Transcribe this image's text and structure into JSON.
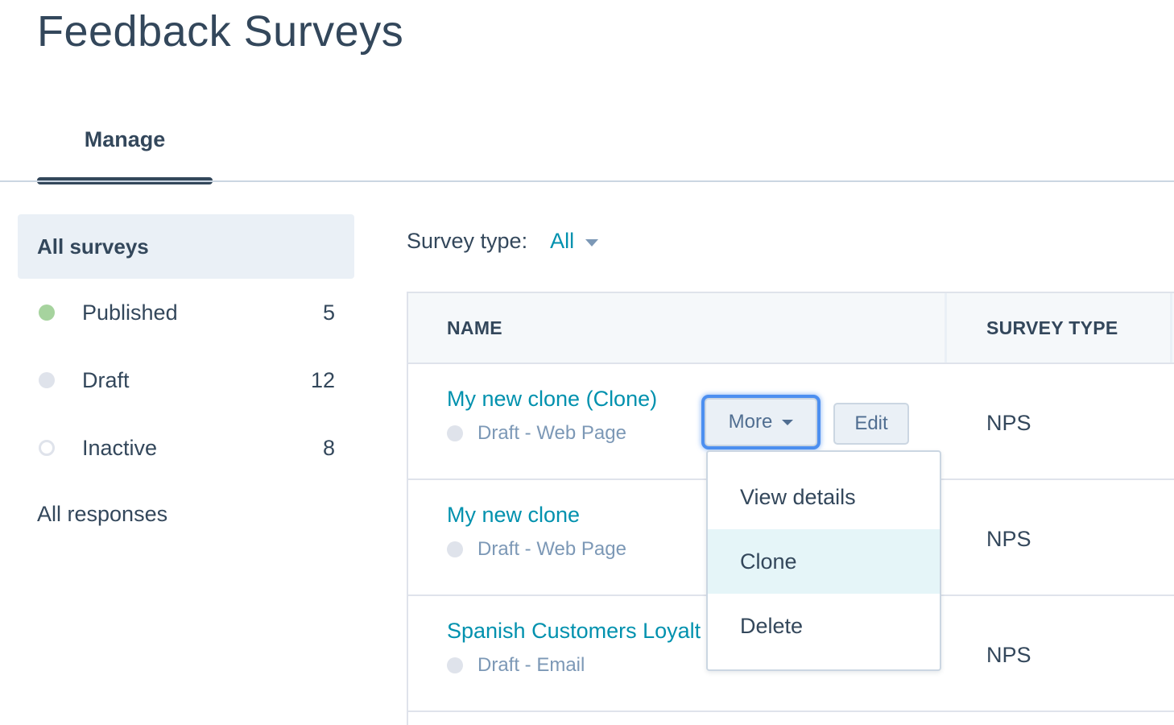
{
  "page": {
    "title": "Feedback Surveys"
  },
  "tabs": [
    {
      "label": "Manage"
    }
  ],
  "sidebar": {
    "active_label": "All surveys",
    "statuses": [
      {
        "label": "Published",
        "count": "5",
        "dot_color": "#a6d39e"
      },
      {
        "label": "Draft",
        "count": "12",
        "dot_color": "#dfe3eb"
      },
      {
        "label": "Inactive",
        "count": "8",
        "dot_color": "hollow"
      }
    ],
    "responses_label": "All responses"
  },
  "filter": {
    "label": "Survey type:",
    "value": "All"
  },
  "table": {
    "columns": [
      "NAME",
      "SURVEY TYPE"
    ],
    "rows": [
      {
        "name": "My new clone (Clone)",
        "status": "Draft - Web Page",
        "type": "NPS"
      },
      {
        "name": "My new clone",
        "status": "Draft - Web Page",
        "type": "NPS"
      },
      {
        "name": "Spanish Customers Loyalt",
        "status": "Draft - Email",
        "type": "NPS"
      }
    ]
  },
  "row_actions": {
    "more_label": "More",
    "edit_label": "Edit"
  },
  "dropdown": {
    "items": [
      "View details",
      "Clone",
      "Delete"
    ],
    "highlighted": "Clone"
  },
  "colors": {
    "link": "#0091ae",
    "text": "#33475b",
    "muted": "#7c98b6",
    "focus_ring": "#4c8ff0"
  }
}
